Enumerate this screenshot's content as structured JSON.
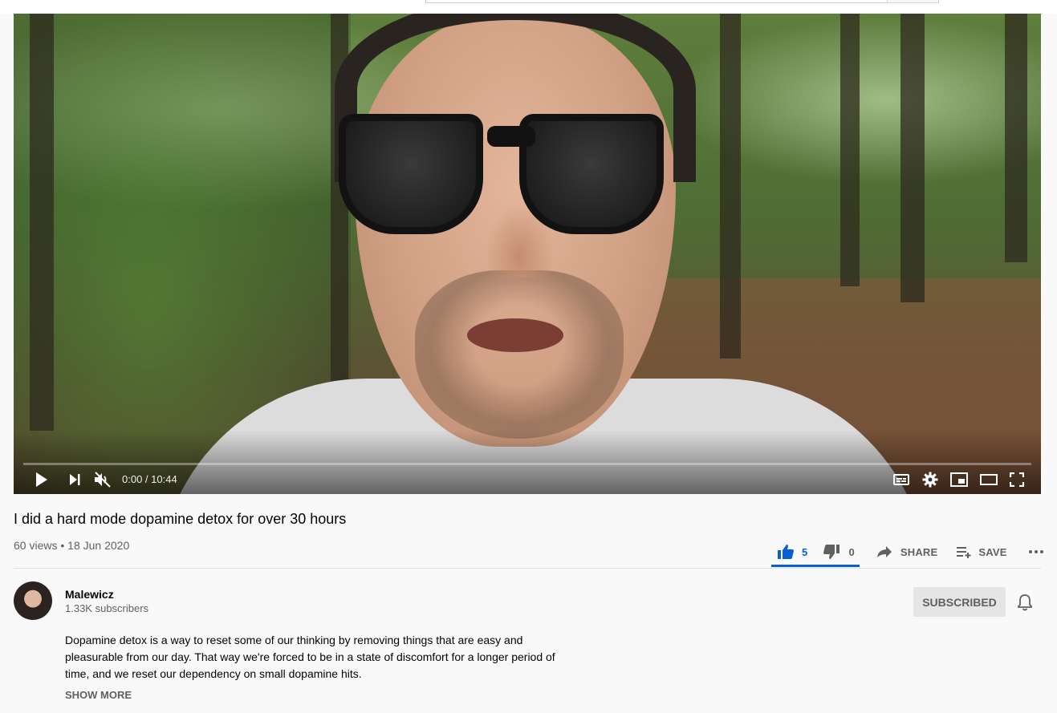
{
  "player": {
    "time_current": "0:00",
    "time_separator": " / ",
    "time_total": "10:44",
    "progress_fraction": 0.0,
    "muted": true
  },
  "video": {
    "title": "I did a hard mode dopamine detox for over 30 hours",
    "views": "60 views",
    "separator": " • ",
    "date": "18 Jun 2020"
  },
  "actions": {
    "likes": "5",
    "dislikes": "0",
    "share_label": "SHARE",
    "save_label": "SAVE",
    "like_fraction": 1.0,
    "like_color": "#065fd4"
  },
  "channel": {
    "name": "Malewicz",
    "subscribers": "1.33K subscribers",
    "subscribe_label": "SUBSCRIBED"
  },
  "description": {
    "text": "Dopamine detox is a way to reset some of our thinking by removing things that are easy and pleasurable from our day. That way we're forced to be in a state of discomfort for a longer period of time, and we reset our dependency on small dopamine hits.",
    "show_more_label": "SHOW MORE"
  },
  "icons": {
    "play": "play-icon",
    "next": "next-icon",
    "volume": "volume-muted-icon",
    "subtitles": "subtitles-icon",
    "settings": "gear-icon",
    "miniplayer": "miniplayer-icon",
    "theater": "theater-mode-icon",
    "fullscreen": "fullscreen-icon",
    "like": "thumbs-up-icon",
    "dislike": "thumbs-down-icon",
    "share": "share-icon",
    "save": "save-playlist-icon",
    "more": "more-icon",
    "bell": "bell-icon"
  }
}
